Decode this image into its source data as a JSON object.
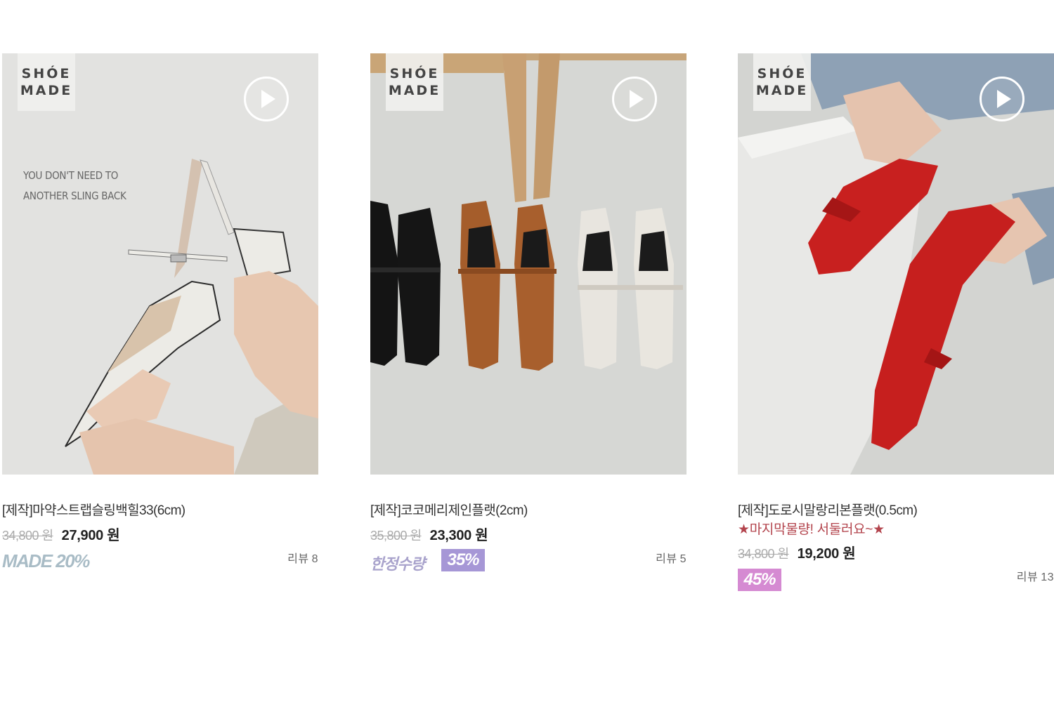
{
  "brand_badge": {
    "line1": "SHÓE",
    "line2": "MADE"
  },
  "icons": {
    "play": "play-icon"
  },
  "products": [
    {
      "overlay_lines": [
        "YOU DON'T NEED TO",
        "ANOTHER SLING BACK"
      ],
      "name": "[제작]마약스트랩슬링백힐33(6cm)",
      "old_price": "34,800 원",
      "new_price": "27,900 원",
      "badge_text": "MADE 20%",
      "review_label": "리뷰",
      "review_count": "8"
    },
    {
      "name": "[제작]코코메리제인플랫(2cm)",
      "old_price": "35,800 원",
      "new_price": "23,300 원",
      "badge_text": "한정수량",
      "badge_pct": "35%",
      "review_label": "리뷰",
      "review_count": "5"
    },
    {
      "name": "[제작]도로시말랑리본플랫(0.5cm)",
      "promo": "★마지막물량! 서둘러요~★",
      "old_price": "34,800 원",
      "new_price": "19,200 원",
      "badge_pct": "45%",
      "review_label": "리뷰",
      "review_count": "13"
    }
  ],
  "colors": {
    "promo_red": "#b3444d",
    "badge_purple": "#a697d6",
    "badge_pink": "#d58ad2",
    "made_badge": "#a9bcc6"
  }
}
